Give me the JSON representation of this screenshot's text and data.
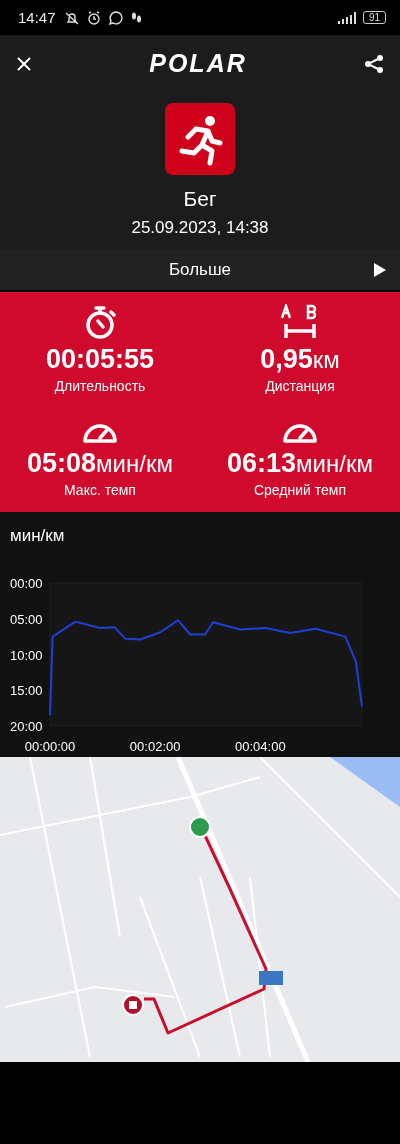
{
  "status_bar": {
    "time": "14:47",
    "battery": "91"
  },
  "header": {
    "logo": "POLAR"
  },
  "activity": {
    "name": "Бег",
    "datetime": "25.09.2023, 14:38"
  },
  "more": {
    "label": "Больше",
    "expanded": false
  },
  "stats": [
    {
      "kind": "duration",
      "value": "00:05:55",
      "label": "Длительность"
    },
    {
      "kind": "distance",
      "value": "0,95",
      "unit": "км",
      "label": "Дистанция"
    },
    {
      "kind": "pace",
      "value": "05:08",
      "unit": "мин/км",
      "label": "Макс. темп"
    },
    {
      "kind": "pace",
      "value": "06:13",
      "unit": "мин/км",
      "label": "Средний темп"
    }
  ],
  "pace_chart": {
    "title": "мин/км",
    "chart_data": {
      "type": "line",
      "x": [
        0,
        3,
        29,
        57,
        74,
        86,
        103,
        126,
        146,
        160,
        177,
        186,
        217,
        246,
        274,
        303,
        337,
        349,
        356
      ],
      "series": [
        {
          "color": "#1f3fd6",
          "values": [
            18.5,
            7.5,
            5.4,
            6.3,
            6.2,
            7.8,
            7.9,
            6.9,
            5.2,
            7.2,
            7.2,
            5.5,
            6.5,
            6.3,
            7.0,
            6.4,
            7.5,
            11.0,
            17.3
          ]
        }
      ],
      "xlim": [
        0,
        356
      ],
      "ylim": [
        20,
        0
      ],
      "xticks": [
        {
          "value": 0,
          "label": "00:00:00"
        },
        {
          "value": 120,
          "label": "00:02:00"
        },
        {
          "value": 240,
          "label": "00:04:00"
        }
      ],
      "yticks": [
        {
          "value": 0,
          "label": "00:00"
        },
        {
          "value": 5,
          "label": "05:00"
        },
        {
          "value": 10,
          "label": "10:00"
        },
        {
          "value": 15,
          "label": "15:00"
        },
        {
          "value": 20,
          "label": "20:00"
        }
      ]
    }
  }
}
